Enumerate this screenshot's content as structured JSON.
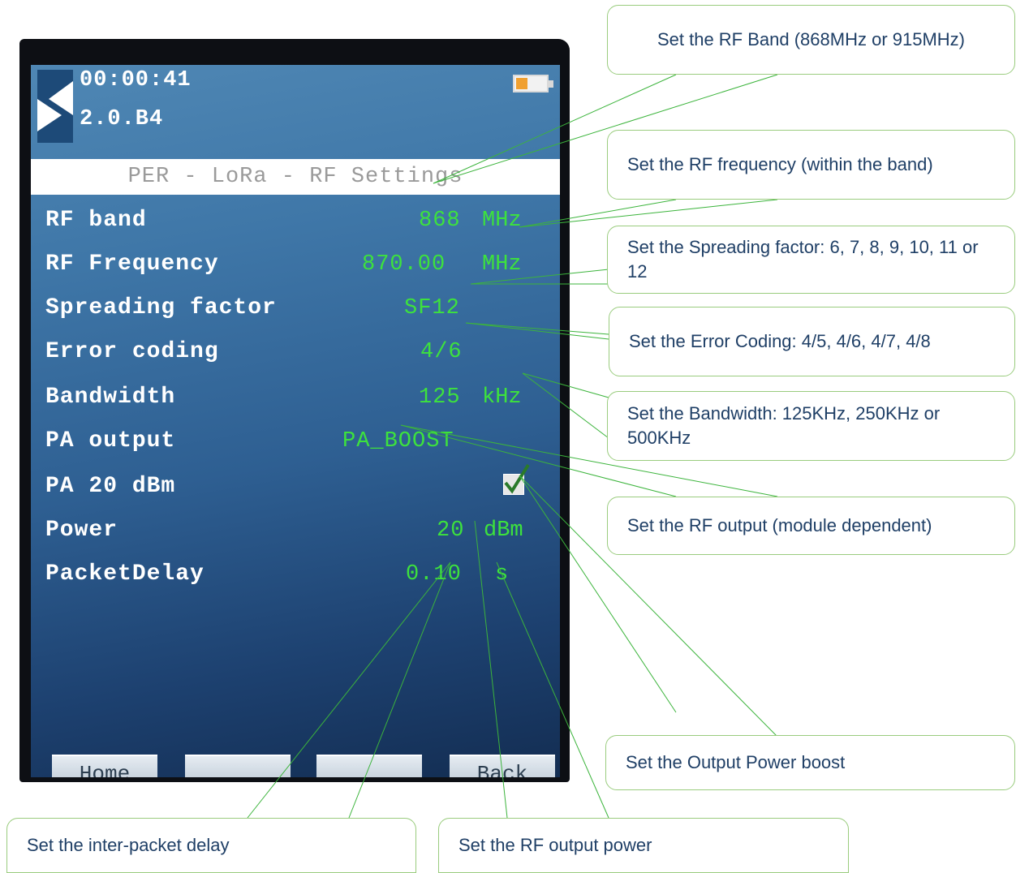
{
  "device": {
    "clock": "00:00:41",
    "version": "2.0.B4",
    "screen_title": "PER - LoRa - RF Settings",
    "settings": [
      {
        "label": "RF band",
        "value": "868",
        "unit": "MHz"
      },
      {
        "label": "RF Frequency",
        "value": "870.00",
        "unit": "MHz"
      },
      {
        "label": "Spreading factor",
        "value": "SF12",
        "unit": ""
      },
      {
        "label": "Error coding",
        "value": "4/6",
        "unit": ""
      },
      {
        "label": "Bandwidth",
        "value": "125",
        "unit": "kHz"
      },
      {
        "label": "PA output",
        "value": "PA_BOOST",
        "unit": ""
      },
      {
        "label": "PA 20 dBm",
        "value": "",
        "unit": "",
        "checked": true
      },
      {
        "label": "Power",
        "value": "20",
        "unit": "dBm"
      },
      {
        "label": "PacketDelay",
        "value": "0.10",
        "unit": "s"
      }
    ],
    "softkeys": [
      "Home",
      "",
      "",
      "Back"
    ]
  },
  "callouts": {
    "rf_band": "Set the RF Band (868MHz or 915MHz)",
    "rf_frequency": "Set the RF frequency (within the band)",
    "spreading_factor": "Set the Spreading factor: 6, 7, 8, 9, 10, 11 or 12",
    "error_coding": "Set the Error Coding: 4/5, 4/6, 4/7, 4/8",
    "bandwidth": "Set the Bandwidth: 125KHz, 250KHz or 500KHz",
    "rf_output": "Set the RF output (module dependent)",
    "power_boost": "Set the Output Power boost",
    "packet_delay": "Set the inter-packet delay",
    "output_power": "Set the RF output power"
  },
  "colors": {
    "value_text": "#3de23d",
    "callout_border": "#9acc7e",
    "leader_line": "#3cb43c",
    "callout_text": "#1f3f66"
  }
}
